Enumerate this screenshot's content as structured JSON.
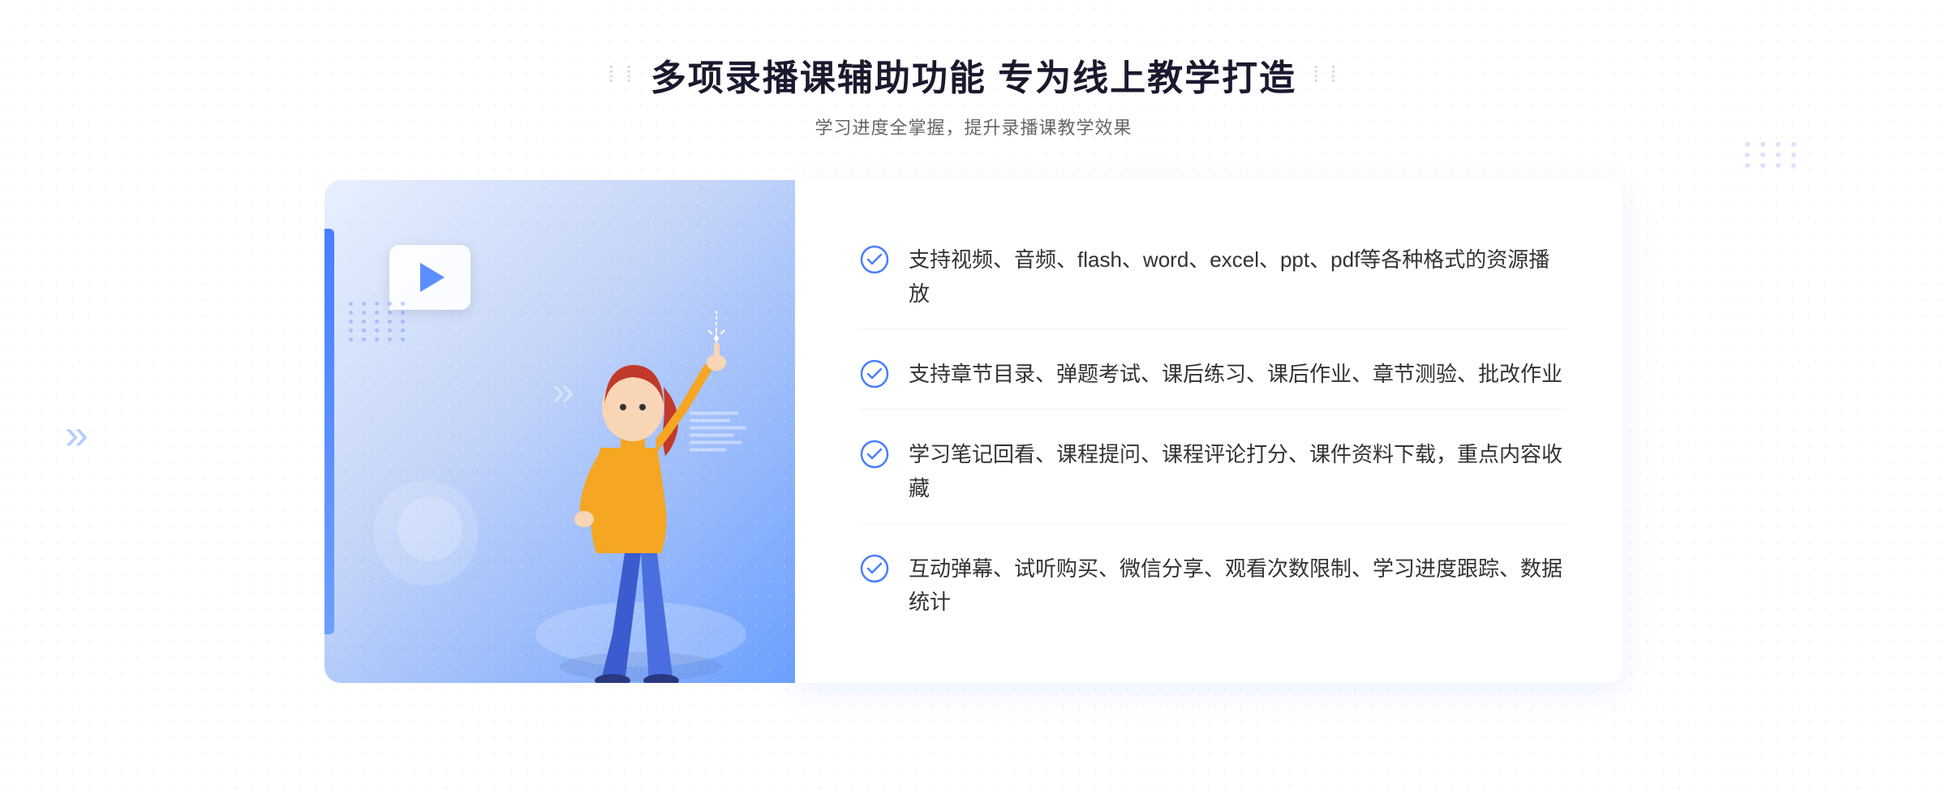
{
  "header": {
    "title": "多项录播课辅助功能 专为线上教学打造",
    "subtitle": "学习进度全掌握，提升录播课教学效果",
    "title_left_deco": "⁞",
    "title_right_deco": "⁞"
  },
  "features": [
    {
      "id": 1,
      "text": "支持视频、音频、flash、word、excel、ppt、pdf等各种格式的资源播放"
    },
    {
      "id": 2,
      "text": "支持章节目录、弹题考试、课后练习、课后作业、章节测验、批改作业"
    },
    {
      "id": 3,
      "text": "学习笔记回看、课程提问、课程评论打分、课件资料下载，重点内容收藏"
    },
    {
      "id": 4,
      "text": "互动弹幕、试听购买、微信分享、观看次数限制、学习进度跟踪、数据统计"
    }
  ],
  "check_icon_color": "#4a7eff",
  "left_arrow_label": "»",
  "colors": {
    "primary": "#4a7eff",
    "title": "#1a1a2e",
    "subtitle": "#888888",
    "feature_text": "#333333",
    "bg_gradient_start": "#e8f0fe",
    "bg_gradient_end": "#6b9fff"
  }
}
